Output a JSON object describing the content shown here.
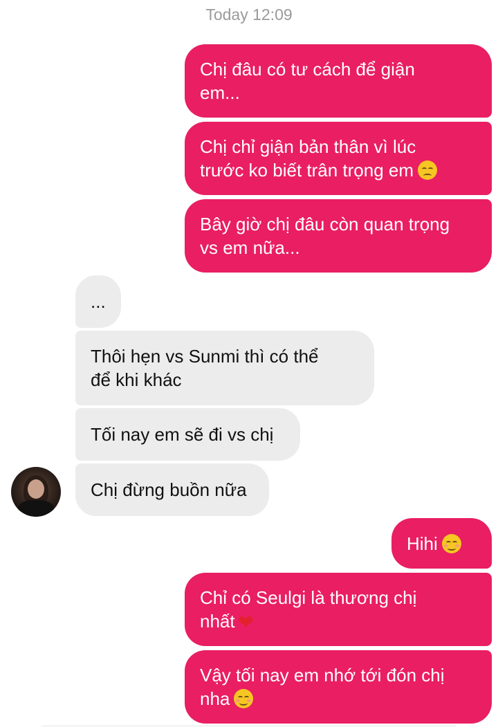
{
  "chat": {
    "timestamp": "Today 12:09",
    "messages": [
      {
        "direction": "outgoing",
        "text": "Chị đâu có tư cách để giận\nem..."
      },
      {
        "direction": "outgoing",
        "text": "Chị chỉ giận bản thân vì lúc\ntrước ko biết trân trọng em",
        "emoji": "pensive-face-icon"
      },
      {
        "direction": "outgoing",
        "text": "Bây giờ chị đâu còn quan trọng\nvs em nữa..."
      },
      {
        "direction": "incoming",
        "text": "..."
      },
      {
        "direction": "incoming",
        "text": "Thôi hẹn vs Sunmi thì có thể\nđể khi khác"
      },
      {
        "direction": "incoming",
        "text": "Tối nay em sẽ đi vs chị"
      },
      {
        "direction": "incoming",
        "text": "Chị đừng buồn nữa"
      },
      {
        "direction": "outgoing",
        "text": "Hihi",
        "emoji": "smiling-face-icon"
      },
      {
        "direction": "outgoing",
        "text": "Chỉ có Seulgi là thương chị\nnhất",
        "emoji": "red-heart-icon"
      },
      {
        "direction": "outgoing",
        "text": "Vậy tối nay em nhớ tới đón chị\nnha",
        "emoji": "smiling-face-icon"
      }
    ]
  },
  "colors": {
    "outgoing_bubble": "#e91e63",
    "incoming_bubble": "#ececec",
    "timestamp_text": "#9a9a9a"
  }
}
